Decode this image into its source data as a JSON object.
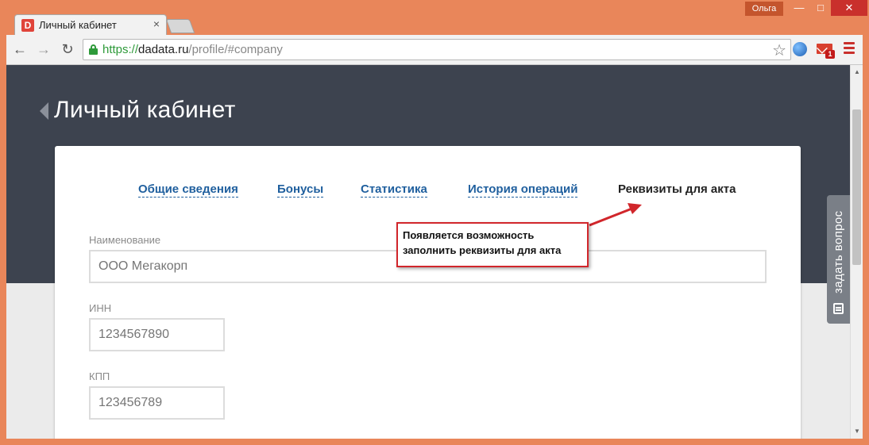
{
  "browser": {
    "tab_title": "Личный кабинет",
    "favicon_letter": "D",
    "tab_close": "×",
    "user_name": "Ольга",
    "win_min": "—",
    "win_max": "□",
    "win_close": "✕",
    "nav_back": "←",
    "nav_forward": "→",
    "nav_reload": "↻",
    "url_scheme": "https://",
    "url_host": "dadata.ru",
    "url_path": "/profile/#company",
    "star": "☆",
    "mail_badge": "1",
    "colors": {
      "frame": "#e9865a",
      "secure": "#2e9a3a",
      "close": "#c9302c"
    }
  },
  "page": {
    "title": "Личный кабинет",
    "tabs": [
      {
        "label": "Общие сведения"
      },
      {
        "label": "Бонусы"
      },
      {
        "label": "Статистика"
      },
      {
        "label": "История операций"
      },
      {
        "label": "Реквизиты для акта",
        "active": true
      }
    ],
    "form": {
      "name_label": "Наименование",
      "name_placeholder": "ООО Мегакорп",
      "inn_label": "ИНН",
      "inn_placeholder": "1234567890",
      "kpp_label": "КПП",
      "kpp_placeholder": "123456789"
    },
    "annotation": {
      "line1": "Появляется возможность",
      "line2": "заполнить реквизиты для акта"
    },
    "ask_widget": "задать вопрос",
    "colors": {
      "hero": "#3d434f",
      "link": "#1f5f9e",
      "callout_border": "#d1262b"
    }
  },
  "scrollbar": {
    "up": "▲",
    "down": "▼"
  }
}
